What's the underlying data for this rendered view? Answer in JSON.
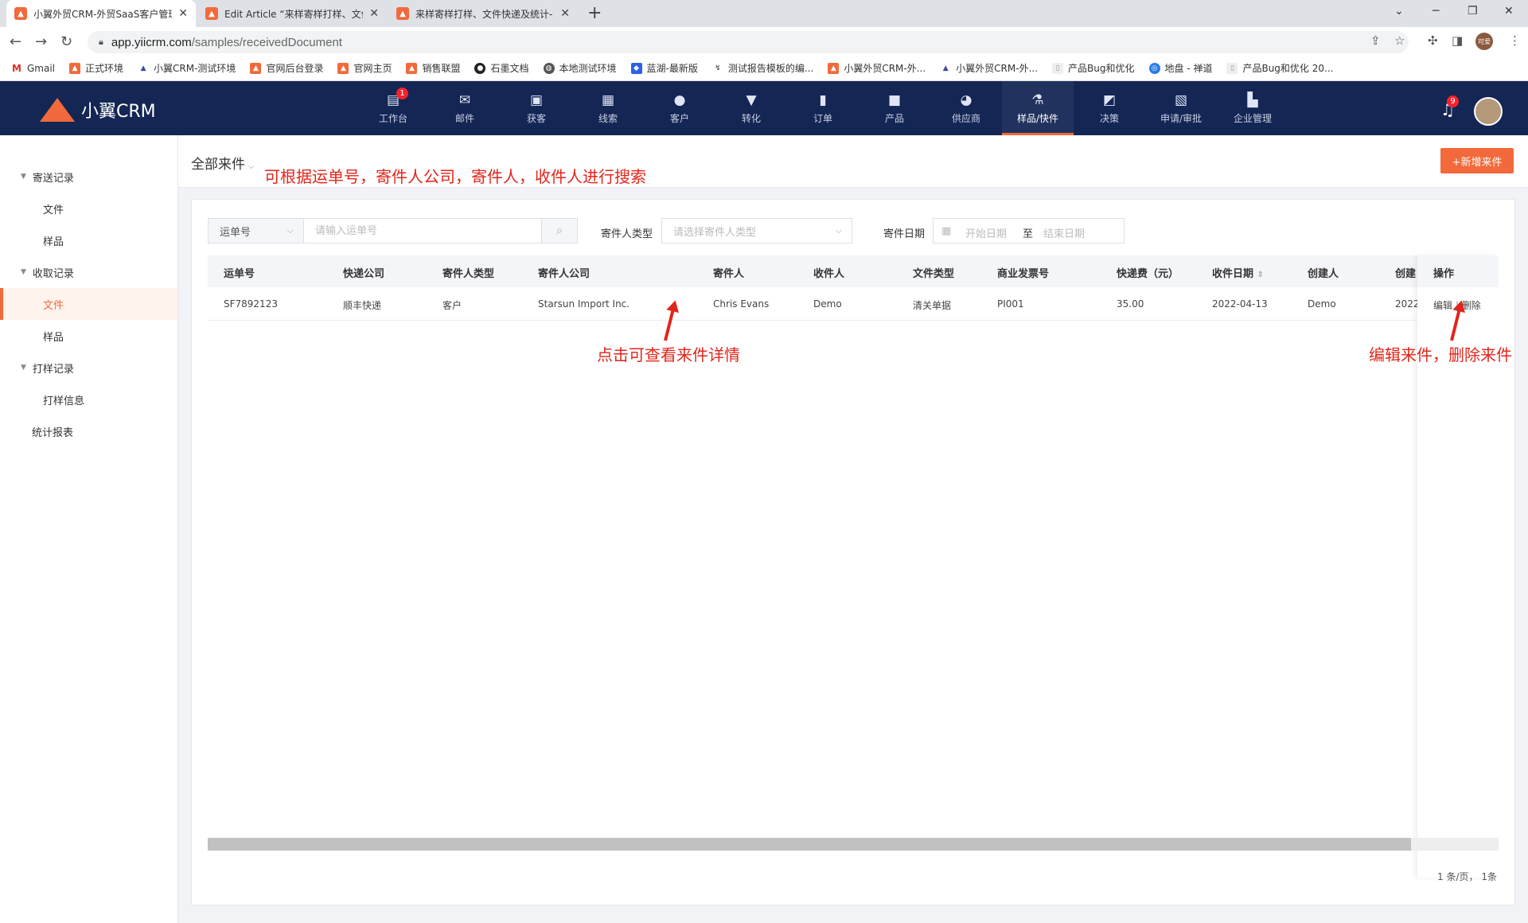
{
  "browser": {
    "tabs": [
      {
        "title": "小翼外贸CRM-外贸SaaS客户管理",
        "active": true
      },
      {
        "title": "Edit Article “来样寄样打样、文件",
        "active": false
      },
      {
        "title": "来样寄样打样、文件快递及统计-",
        "active": false
      }
    ],
    "url_host": "app.yiicrm.com",
    "url_path": "/samples/receivedDocument",
    "profile_label": "可爱",
    "bookmarks": [
      "Gmail",
      "正式环境",
      "小翼CRM-测试环境",
      "官网后台登录",
      "官网主页",
      "销售联盟",
      "石墨文档",
      "本地测试环境",
      "蓝湖-最新版",
      "测试报告模板的编...",
      "小翼外贸CRM-外...",
      "小翼外贸CRM-外...",
      "产品Bug和优化",
      "地盘 - 禅道",
      "产品Bug和优化 20..."
    ]
  },
  "app": {
    "logo_text": "小翼CRM",
    "nav": [
      {
        "label": "工作台",
        "icon": "workbench-icon",
        "badge": "1"
      },
      {
        "label": "邮件",
        "icon": "mail-icon"
      },
      {
        "label": "获客",
        "icon": "acquire-icon"
      },
      {
        "label": "线索",
        "icon": "leads-icon"
      },
      {
        "label": "客户",
        "icon": "customer-icon"
      },
      {
        "label": "转化",
        "icon": "funnel-icon"
      },
      {
        "label": "订单",
        "icon": "order-icon"
      },
      {
        "label": "产品",
        "icon": "product-icon"
      },
      {
        "label": "供应商",
        "icon": "supplier-icon"
      },
      {
        "label": "样品/快件",
        "icon": "flask-icon",
        "active": true
      },
      {
        "label": "决策",
        "icon": "chart-icon"
      },
      {
        "label": "申请/审批",
        "icon": "approval-icon"
      },
      {
        "label": "企业管理",
        "icon": "building-icon"
      }
    ],
    "notification_count": "9"
  },
  "sidebar": {
    "groups": [
      {
        "label": "寄送记录",
        "items": [
          "文件",
          "样品"
        ]
      },
      {
        "label": "收取记录",
        "items": [
          "文件",
          "样品"
        ]
      },
      {
        "label": "打样记录",
        "items": [
          "打样信息"
        ]
      }
    ],
    "extra": "统计报表",
    "active": "收取记录/文件"
  },
  "page": {
    "title": "全部来件",
    "add_button": "+新增来件"
  },
  "filters": {
    "search_field": "运单号",
    "search_placeholder": "请输入运单号",
    "sender_type_label": "寄件人类型",
    "sender_type_placeholder": "请选择寄件人类型",
    "date_label": "寄件日期",
    "date_start": "开始日期",
    "date_sep": "至",
    "date_end": "结束日期"
  },
  "table": {
    "columns": [
      "运单号",
      "快递公司",
      "寄件人类型",
      "寄件人公司",
      "寄件人",
      "收件人",
      "文件类型",
      "商业发票号",
      "快递费（元）",
      "收件日期",
      "创建人",
      "创建"
    ],
    "action_header": "操作",
    "rows": [
      {
        "cells": [
          "SF7892123",
          "顺丰快递",
          "客户",
          "Starsun Import Inc.",
          "Chris Evans",
          "Demo",
          "清关单据",
          "PI001",
          "35.00",
          "2022-04-13",
          "Demo",
          "2022"
        ],
        "edit": "编辑",
        "sep": "|",
        "delete": "删除"
      }
    ],
    "pager": "1 条/页，  1条"
  },
  "annotations": {
    "search_note": "可根据运单号，寄件人公司，寄件人，收件人进行搜索",
    "detail_note": "点击可查看来件详情",
    "action_note": "编辑来件，删除来件",
    "color": "#e1251b"
  },
  "colors": {
    "brand": "#f26a3b",
    "navbar": "#142654"
  }
}
